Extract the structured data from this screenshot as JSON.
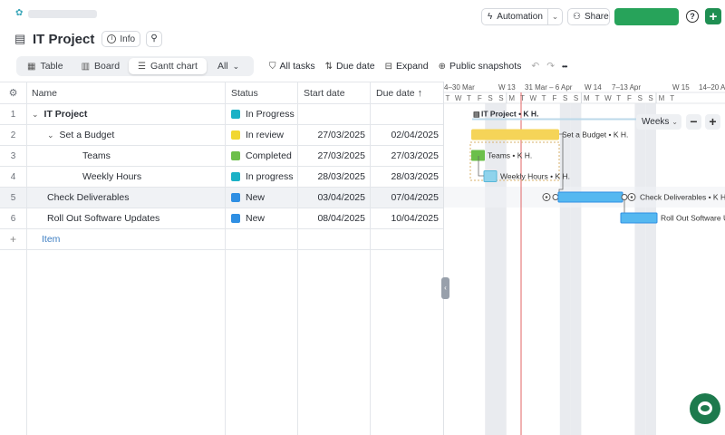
{
  "header": {
    "title": "IT Project",
    "info_label": "Info",
    "automation_label": "Automation",
    "share_label": "Share",
    "help_label": "?",
    "add_label": "+"
  },
  "views": {
    "table": "Table",
    "board": "Board",
    "gantt": "Gantt chart",
    "all": "All"
  },
  "toolbar": {
    "all_tasks": "All tasks",
    "due_date": "Due date",
    "expand": "Expand",
    "snapshots": "Public snapshots",
    "more": "•••"
  },
  "table": {
    "columns": [
      "Name",
      "Status",
      "Start date",
      "Due date"
    ],
    "due_sort_indicator": "↑",
    "rows": [
      {
        "num": "1",
        "name": "IT Project",
        "indent": 0,
        "chevron": "⌄",
        "status": "In Progress",
        "status_color": "#1bb1c6",
        "start": "",
        "due": ""
      },
      {
        "num": "2",
        "name": "Set a Budget",
        "indent": 1,
        "chevron": "⌄",
        "status": "In review",
        "status_color": "#f1d731",
        "start": "27/03/2025",
        "due": "02/04/2025"
      },
      {
        "num": "3",
        "name": "Teams",
        "indent": 2,
        "chevron": "",
        "status": "Completed",
        "status_color": "#6cbf4a",
        "start": "27/03/2025",
        "due": "27/03/2025"
      },
      {
        "num": "4",
        "name": "Weekly Hours",
        "indent": 2,
        "chevron": "",
        "status": "In progress",
        "status_color": "#1bb1c6",
        "start": "28/03/2025",
        "due": "28/03/2025"
      },
      {
        "num": "5",
        "name": "Check Deliverables",
        "indent": 1,
        "chevron": "",
        "status": "New",
        "status_color": "#2f8fe3",
        "start": "03/04/2025",
        "due": "07/04/2025"
      },
      {
        "num": "6",
        "name": "Roll Out Software Updates",
        "indent": 1,
        "chevron": "",
        "status": "New",
        "status_color": "#2f8fe3",
        "start": "08/04/2025",
        "due": "10/04/2025"
      }
    ],
    "add_item_label": "Item"
  },
  "gantt": {
    "weeks": [
      {
        "label": "4–30 Mar",
        "days": [
          "T",
          "W",
          "T",
          "F",
          "S",
          "S"
        ]
      },
      {
        "label": "W 13",
        "days": []
      },
      {
        "label": "31 Mar – 6 Apr",
        "days": [
          "M",
          "T",
          "W",
          "T",
          "F",
          "S",
          "S"
        ]
      },
      {
        "label": "W 14",
        "days": []
      },
      {
        "label": "7–13 Apr",
        "days": [
          "M",
          "T",
          "W",
          "T",
          "F",
          "S",
          "S"
        ]
      },
      {
        "label": "W 15",
        "days": []
      },
      {
        "label": "14–20 A",
        "days": [
          "M",
          "T"
        ]
      }
    ],
    "scale_label": "Weeks",
    "zoom_out": "−",
    "zoom_in": "+",
    "bars": [
      {
        "label": "IT Project • K H.",
        "color": "#bfc4cc"
      },
      {
        "label": "Set a Budget • K H.",
        "color": "#f5d458"
      },
      {
        "label": "Teams • K H.",
        "color": "#6cbf4a"
      },
      {
        "label": "Weekly Hours • K H.",
        "color": "#8fd3ec"
      },
      {
        "label": "Check Deliverables • K H.",
        "color": "#55b8f0"
      },
      {
        "label": "Roll Out Software U",
        "color": "#55b8f0"
      }
    ]
  }
}
